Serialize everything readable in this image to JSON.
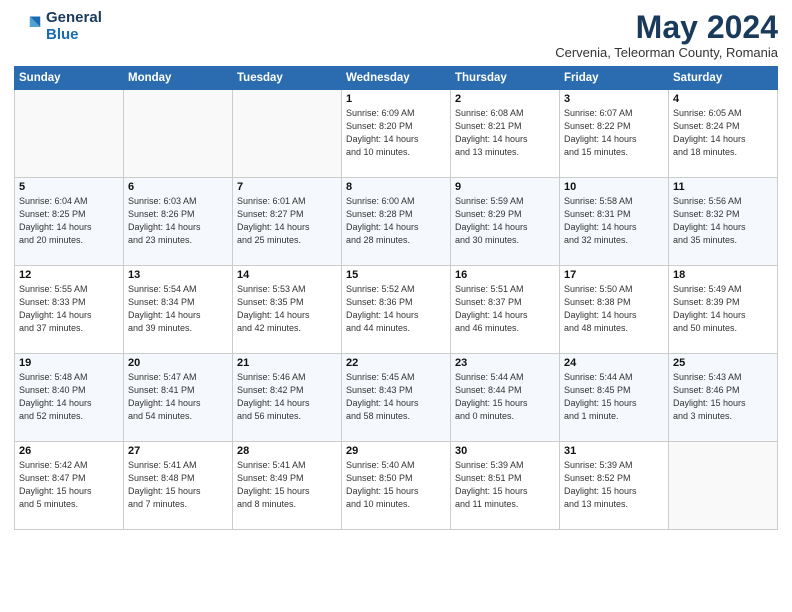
{
  "logo": {
    "general": "General",
    "blue": "Blue"
  },
  "header": {
    "month_title": "May 2024",
    "subtitle": "Cervenia, Teleorman County, Romania"
  },
  "weekdays": [
    "Sunday",
    "Monday",
    "Tuesday",
    "Wednesday",
    "Thursday",
    "Friday",
    "Saturday"
  ],
  "weeks": [
    [
      {
        "day": "",
        "info": ""
      },
      {
        "day": "",
        "info": ""
      },
      {
        "day": "",
        "info": ""
      },
      {
        "day": "1",
        "info": "Sunrise: 6:09 AM\nSunset: 8:20 PM\nDaylight: 14 hours\nand 10 minutes."
      },
      {
        "day": "2",
        "info": "Sunrise: 6:08 AM\nSunset: 8:21 PM\nDaylight: 14 hours\nand 13 minutes."
      },
      {
        "day": "3",
        "info": "Sunrise: 6:07 AM\nSunset: 8:22 PM\nDaylight: 14 hours\nand 15 minutes."
      },
      {
        "day": "4",
        "info": "Sunrise: 6:05 AM\nSunset: 8:24 PM\nDaylight: 14 hours\nand 18 minutes."
      }
    ],
    [
      {
        "day": "5",
        "info": "Sunrise: 6:04 AM\nSunset: 8:25 PM\nDaylight: 14 hours\nand 20 minutes."
      },
      {
        "day": "6",
        "info": "Sunrise: 6:03 AM\nSunset: 8:26 PM\nDaylight: 14 hours\nand 23 minutes."
      },
      {
        "day": "7",
        "info": "Sunrise: 6:01 AM\nSunset: 8:27 PM\nDaylight: 14 hours\nand 25 minutes."
      },
      {
        "day": "8",
        "info": "Sunrise: 6:00 AM\nSunset: 8:28 PM\nDaylight: 14 hours\nand 28 minutes."
      },
      {
        "day": "9",
        "info": "Sunrise: 5:59 AM\nSunset: 8:29 PM\nDaylight: 14 hours\nand 30 minutes."
      },
      {
        "day": "10",
        "info": "Sunrise: 5:58 AM\nSunset: 8:31 PM\nDaylight: 14 hours\nand 32 minutes."
      },
      {
        "day": "11",
        "info": "Sunrise: 5:56 AM\nSunset: 8:32 PM\nDaylight: 14 hours\nand 35 minutes."
      }
    ],
    [
      {
        "day": "12",
        "info": "Sunrise: 5:55 AM\nSunset: 8:33 PM\nDaylight: 14 hours\nand 37 minutes."
      },
      {
        "day": "13",
        "info": "Sunrise: 5:54 AM\nSunset: 8:34 PM\nDaylight: 14 hours\nand 39 minutes."
      },
      {
        "day": "14",
        "info": "Sunrise: 5:53 AM\nSunset: 8:35 PM\nDaylight: 14 hours\nand 42 minutes."
      },
      {
        "day": "15",
        "info": "Sunrise: 5:52 AM\nSunset: 8:36 PM\nDaylight: 14 hours\nand 44 minutes."
      },
      {
        "day": "16",
        "info": "Sunrise: 5:51 AM\nSunset: 8:37 PM\nDaylight: 14 hours\nand 46 minutes."
      },
      {
        "day": "17",
        "info": "Sunrise: 5:50 AM\nSunset: 8:38 PM\nDaylight: 14 hours\nand 48 minutes."
      },
      {
        "day": "18",
        "info": "Sunrise: 5:49 AM\nSunset: 8:39 PM\nDaylight: 14 hours\nand 50 minutes."
      }
    ],
    [
      {
        "day": "19",
        "info": "Sunrise: 5:48 AM\nSunset: 8:40 PM\nDaylight: 14 hours\nand 52 minutes."
      },
      {
        "day": "20",
        "info": "Sunrise: 5:47 AM\nSunset: 8:41 PM\nDaylight: 14 hours\nand 54 minutes."
      },
      {
        "day": "21",
        "info": "Sunrise: 5:46 AM\nSunset: 8:42 PM\nDaylight: 14 hours\nand 56 minutes."
      },
      {
        "day": "22",
        "info": "Sunrise: 5:45 AM\nSunset: 8:43 PM\nDaylight: 14 hours\nand 58 minutes."
      },
      {
        "day": "23",
        "info": "Sunrise: 5:44 AM\nSunset: 8:44 PM\nDaylight: 15 hours\nand 0 minutes."
      },
      {
        "day": "24",
        "info": "Sunrise: 5:44 AM\nSunset: 8:45 PM\nDaylight: 15 hours\nand 1 minute."
      },
      {
        "day": "25",
        "info": "Sunrise: 5:43 AM\nSunset: 8:46 PM\nDaylight: 15 hours\nand 3 minutes."
      }
    ],
    [
      {
        "day": "26",
        "info": "Sunrise: 5:42 AM\nSunset: 8:47 PM\nDaylight: 15 hours\nand 5 minutes."
      },
      {
        "day": "27",
        "info": "Sunrise: 5:41 AM\nSunset: 8:48 PM\nDaylight: 15 hours\nand 7 minutes."
      },
      {
        "day": "28",
        "info": "Sunrise: 5:41 AM\nSunset: 8:49 PM\nDaylight: 15 hours\nand 8 minutes."
      },
      {
        "day": "29",
        "info": "Sunrise: 5:40 AM\nSunset: 8:50 PM\nDaylight: 15 hours\nand 10 minutes."
      },
      {
        "day": "30",
        "info": "Sunrise: 5:39 AM\nSunset: 8:51 PM\nDaylight: 15 hours\nand 11 minutes."
      },
      {
        "day": "31",
        "info": "Sunrise: 5:39 AM\nSunset: 8:52 PM\nDaylight: 15 hours\nand 13 minutes."
      },
      {
        "day": "",
        "info": ""
      }
    ]
  ]
}
